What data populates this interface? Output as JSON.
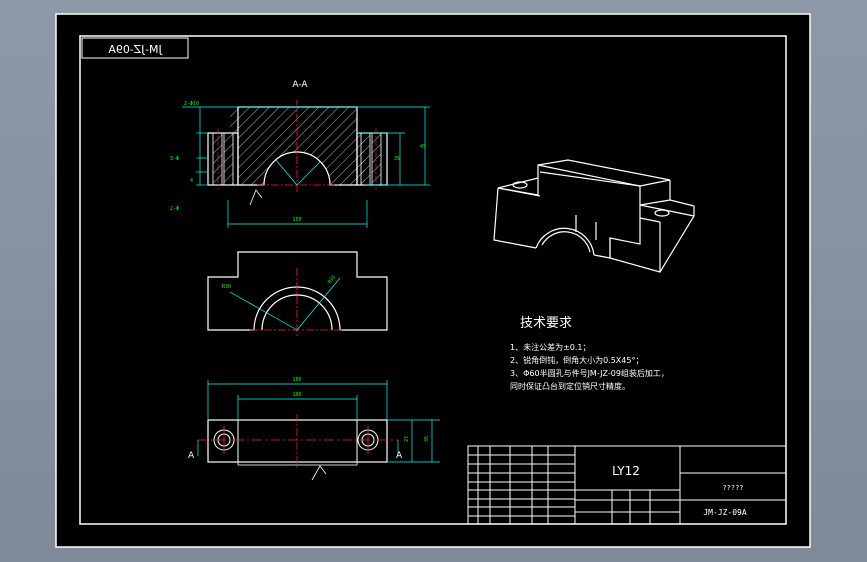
{
  "drawing": {
    "number_mirrored": "JM-JZ-09A",
    "section_label": "A-A",
    "cut_label_left": "A",
    "cut_label_right": "A",
    "dim_labels": {
      "total_width": "180",
      "hole_spacing": "150",
      "top_width": "100",
      "height_outer": "35",
      "height_inner": "27",
      "radius_a": "R30",
      "radius_b": "R35"
    }
  },
  "tech_requirements": {
    "title": "技术要求",
    "lines": [
      "1、未注公差为±0.1；",
      "2、锐角倒钝，倒角大小为0.5X45°；",
      "3、Φ60半圆孔与件号JM-JZ-09组装后加工，",
      "同时保证凸台到定位销尺寸精度。"
    ]
  },
  "title_block": {
    "material": "LY12",
    "company": "?????",
    "drawing_no": "JM-JZ-09A"
  },
  "colors": {
    "paper": "#000000",
    "line": "#ffffff",
    "dimension": "#00ffff",
    "center": "#ff0000",
    "text_green": "#00ff00",
    "hatch": "#ffffff"
  }
}
